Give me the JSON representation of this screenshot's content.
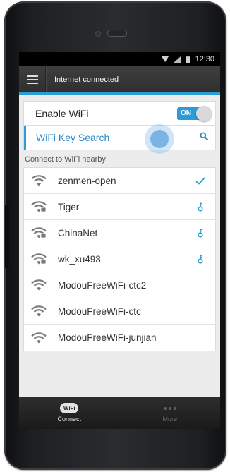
{
  "status_bar": {
    "time": "12:30"
  },
  "app_bar": {
    "title": "Internet connected"
  },
  "settings": {
    "enable_wifi_label": "Enable WiFi",
    "toggle_label": "ON",
    "search_label": "WiFi Key Search"
  },
  "section_header": "Connect to WiFi nearby",
  "networks": [
    {
      "name": "zenmen-open",
      "status": "connected"
    },
    {
      "name": "Tiger",
      "status": "key"
    },
    {
      "name": "ChinaNet",
      "status": "key"
    },
    {
      "name": "wk_xu493",
      "status": "key"
    },
    {
      "name": "ModouFreeWiFi-ctc2",
      "status": "none"
    },
    {
      "name": "ModouFreeWiFi-ctc",
      "status": "none"
    },
    {
      "name": "ModouFreeWiFi-junjian",
      "status": "none"
    }
  ],
  "tabs": {
    "connect": {
      "badge": "WiFi",
      "label": "Connect"
    },
    "more": {
      "label": "More"
    }
  },
  "colors": {
    "accent": "#2d9bd6",
    "search_text": "#2d86c8",
    "app_bar": "#3a3a3a",
    "tab_bar": "#222222"
  },
  "icons": {
    "menu": "menu-icon",
    "wifi": "wifi-icon",
    "search": "search-icon",
    "connected": "checkmark-icon",
    "key": "key-icon"
  }
}
